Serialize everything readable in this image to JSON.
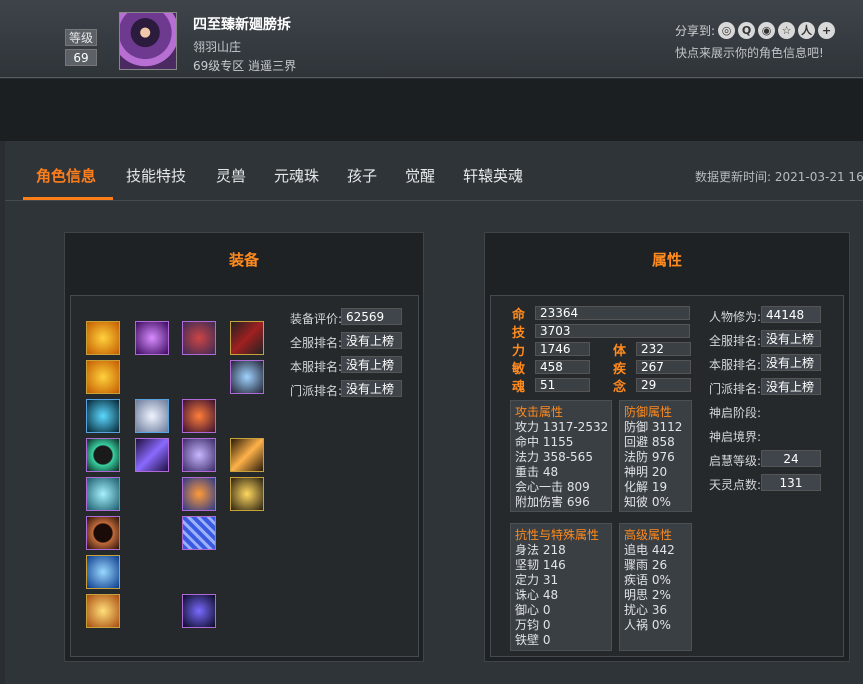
{
  "character": {
    "level_label": "等级",
    "level": "69",
    "name": "四至臻新廽膀拆",
    "sect": "翎羽山庄",
    "server": "69级专区 逍遥三界"
  },
  "share": {
    "label": "分享到:",
    "tip": "快点来展示你的角色信息吧!",
    "icons": [
      "wechat-icon",
      "qq-icon",
      "weibo-icon",
      "qzone-icon",
      "renren-icon",
      "more-icon"
    ]
  },
  "tabs": [
    "角色信息",
    "技能特技",
    "灵兽",
    "元魂珠",
    "孩子",
    "觉醒",
    "轩辕英魂"
  ],
  "update": {
    "label": "数据更新时间:",
    "value": "2021-03-21 16"
  },
  "equip": {
    "title": "装备",
    "score_label": "装备评价:",
    "score": "62569",
    "ranks": [
      {
        "label": "全服排名:",
        "value": "没有上榜"
      },
      {
        "label": "本服排名:",
        "value": "没有上榜"
      },
      {
        "label": "门派排名:",
        "value": "没有上榜"
      }
    ]
  },
  "attr": {
    "title": "属性",
    "hp": {
      "k": "命",
      "v": "23364"
    },
    "skill": {
      "k": "技",
      "v": "3703"
    },
    "pairs": [
      [
        {
          "k": "力",
          "v": "1746"
        },
        {
          "k": "体",
          "v": "232"
        }
      ],
      [
        {
          "k": "敏",
          "v": "458"
        },
        {
          "k": "疾",
          "v": "267"
        }
      ],
      [
        {
          "k": "魂",
          "v": "51"
        },
        {
          "k": "念",
          "v": "29"
        }
      ]
    ],
    "right": [
      {
        "label": "人物修为:",
        "value": "44148"
      },
      {
        "label": "全服排名:",
        "value": "没有上榜"
      },
      {
        "label": "本服排名:",
        "value": "没有上榜"
      },
      {
        "label": "门派排名:",
        "value": "没有上榜"
      },
      {
        "label": "神启阶段:",
        "value": ""
      },
      {
        "label": "神启境界:",
        "value": ""
      },
      {
        "label": "启慧等级:",
        "value": "24"
      },
      {
        "label": "天灵点数:",
        "value": "131"
      }
    ],
    "attack": {
      "title": "攻击属性",
      "rows": [
        "攻力 1317-2532",
        "命中 1155",
        "法力 358-565",
        "重击 48",
        "会心一击 809",
        "附加伤害 696"
      ]
    },
    "defense": {
      "title": "防御属性",
      "rows": [
        "防御 3112",
        "回避 858",
        "法防 976",
        "神明 20",
        "化解 19",
        "知彼 0%"
      ]
    },
    "resist": {
      "title": "抗性与特殊属性",
      "rows": [
        "身法 218",
        "坚韧 146",
        "定力 31",
        "诛心 48",
        "御心 0",
        "万钧 0",
        "铁壁 0"
      ]
    },
    "advanced": {
      "title": "高级属性",
      "rows": [
        "追电 442",
        "骤雨 26",
        "疾语 0%",
        "明思 2%",
        "扰心 36",
        "人祸 0%"
      ]
    }
  }
}
